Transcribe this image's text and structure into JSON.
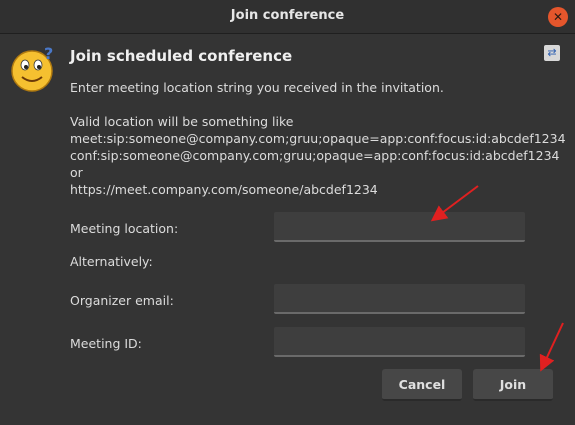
{
  "window": {
    "title": "Join conference",
    "close_icon": "close-icon"
  },
  "dialog": {
    "heading": "Join scheduled conference",
    "icon": "smiley-icon",
    "side_icon": "swap-icon",
    "instruction": "Enter meeting location string you received in the invitation.",
    "example_intro": "Valid location will be something like",
    "example_1": "meet:sip:someone@company.com;gruu;opaque=app:conf:focus:id:abcdef1234",
    "example_2": "conf:sip:someone@company.com;gruu;opaque=app:conf:focus:id:abcdef1234",
    "example_or": "or",
    "example_3": "https://meet.company.com/someone/abcdef1234"
  },
  "form": {
    "meeting_location_label": "Meeting location:",
    "meeting_location_value": "",
    "alternatively_label": "Alternatively:",
    "organizer_email_label": "Organizer email:",
    "organizer_email_value": "",
    "meeting_id_label": "Meeting ID:",
    "meeting_id_value": ""
  },
  "buttons": {
    "cancel_label": "Cancel",
    "join_label": "Join"
  },
  "colors": {
    "close_button": "#e5562c",
    "annotation_arrow": "#e02020",
    "background": "#343434"
  }
}
